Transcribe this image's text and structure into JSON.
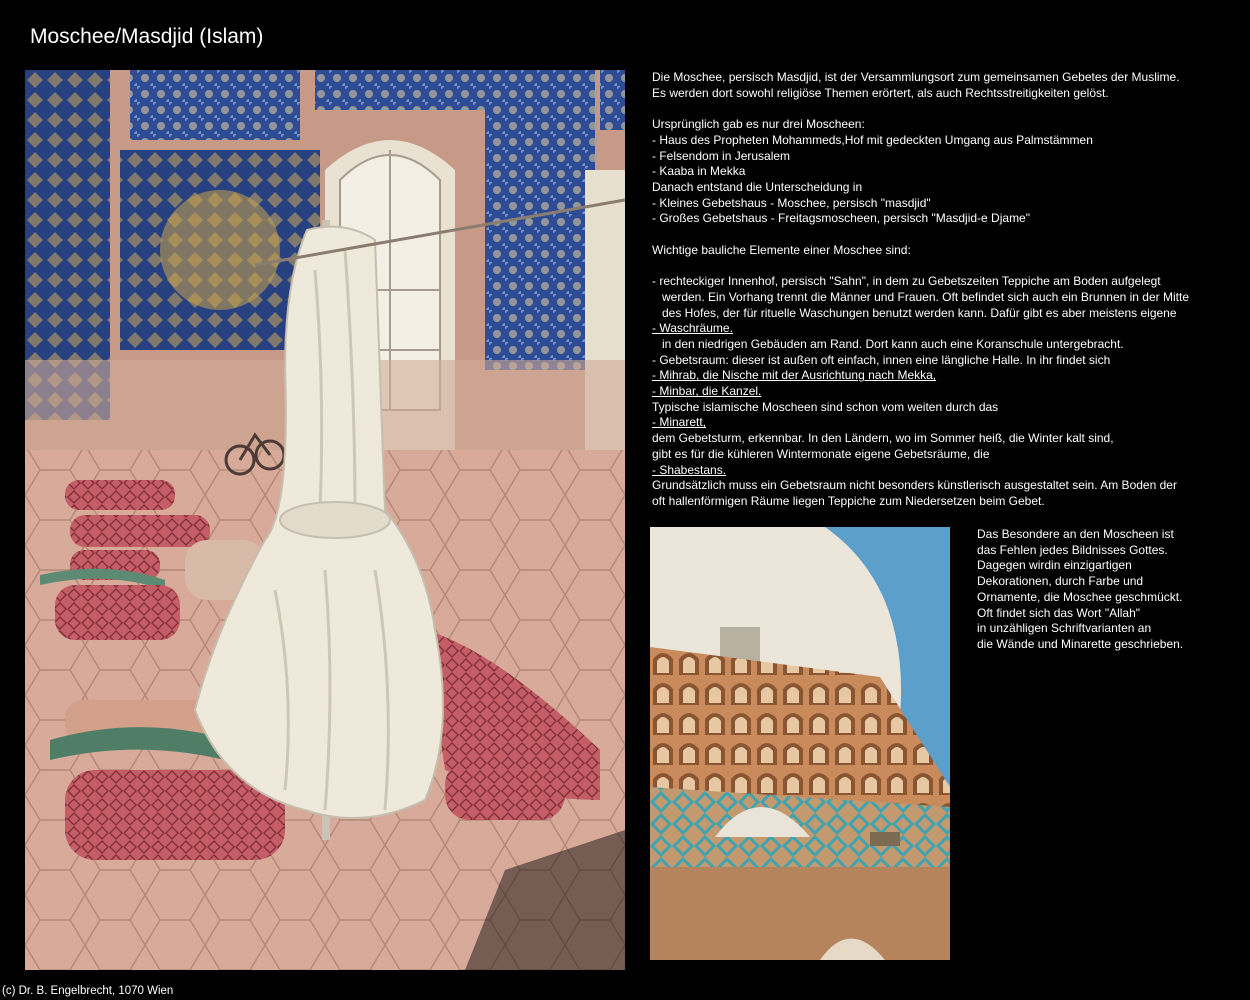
{
  "page": {
    "title": "Moschee/Masdjid (Islam)",
    "footer": "(c) Dr. B. Engelbrecht, 1070 Wien"
  },
  "main_text": [
    {
      "text": "Die Moschee, persisch Masdjid, ist der Versammlungsort zum gemeinsamen Gebetes der Muslime.",
      "underline": false
    },
    {
      "text": "Es werden dort sowohl religiöse Themen erörtert, als auch Rechtsstreitigkeiten gelöst.",
      "underline": false
    },
    {
      "text": "",
      "underline": false
    },
    {
      "text": "Ursprünglich gab es nur drei Moscheen:",
      "underline": false
    },
    {
      "text": "- Haus des Propheten Mohammeds,Hof mit gedeckten Umgang aus Palmstämmen",
      "underline": false
    },
    {
      "text": "- Felsendom in Jerusalem",
      "underline": false
    },
    {
      "text": "- Kaaba in Mekka",
      "underline": false
    },
    {
      "text": "Danach entstand die Unterscheidung in",
      "underline": false
    },
    {
      "text": "- Kleines Gebetshaus - Moschee, persisch \"masdjid\"",
      "underline": false
    },
    {
      "text": "- Großes Gebetshaus - Freitagsmoscheen, persisch \"Masdjid-e Djame\"",
      "underline": false
    },
    {
      "text": "",
      "underline": false
    },
    {
      "text": "Wichtige bauliche Elemente einer Moschee sind:",
      "underline": false
    },
    {
      "text": "",
      "underline": false
    },
    {
      "text": "- rechteckiger Innenhof, persisch \"Sahn\", in dem zu Gebetszeiten Teppiche am Boden aufgelegt",
      "underline": false
    },
    {
      "text": "   werden. Ein Vorhang trennt die Männer und Frauen. Oft befindet sich auch ein Brunnen in der Mitte",
      "underline": false
    },
    {
      "text": "   des Hofes, der für rituelle Waschungen benutzt werden kann. Dafür gibt es aber meistens eigene",
      "underline": false
    },
    {
      "text": "- Waschräume.",
      "underline": true
    },
    {
      "text": "   in den niedrigen Gebäuden am Rand. Dort kann auch eine Koranschule untergebracht.",
      "underline": false
    },
    {
      "text": "- Gebetsraum: dieser ist außen oft einfach, innen eine längliche Halle. In ihr findet sich",
      "underline": false
    },
    {
      "text": "- Mihrab, die Nische mit der Ausrichtung nach Mekka,",
      "underline": true
    },
    {
      "text": "- Minbar, die Kanzel.",
      "underline": true
    },
    {
      "text": "Typische islamische Moscheen sind schon vom weiten durch das",
      "underline": false
    },
    {
      "text": "- Minarett,",
      "underline": true
    },
    {
      "text": "dem Gebetsturm, erkennbar. In den Ländern, wo im Sommer heiß, die Winter kalt sind,",
      "underline": false
    },
    {
      "text": "gibt es für die kühleren Wintermonate eigene Gebetsräume, die",
      "underline": false
    },
    {
      "text": "- Shabestans.",
      "underline": true
    },
    {
      "text": "Grundsätzlich muss ein Gebetsraum nicht besonders künstlerisch ausgestaltet sein. Am Boden der",
      "underline": false
    },
    {
      "text": "oft hallenförmigen Räume liegen Teppiche zum Niedersetzen beim Gebet.",
      "underline": false
    }
  ],
  "side_text": [
    "Das Besondere an den Moscheen ist",
    "das Fehlen jedes Bildnisses Gottes.",
    "Dagegen wirdin einzigartigen",
    "Dekorationen, durch Farbe und",
    "Ornamente, die Moschee geschmückt.",
    "Oft findet sich das Wort \"Allah\"",
    "in unzähligen Schriftvarianten an",
    "die Wände und Minarette geschrieben."
  ],
  "colors": {
    "background": "#000000",
    "text": "#ffffff",
    "tile_blue": "#2f4f9a",
    "carpet_red": "#c8626a",
    "curtain_cream": "#efe9dc",
    "sky_blue": "#5b9fca",
    "brick_tan": "#c98a5a"
  }
}
